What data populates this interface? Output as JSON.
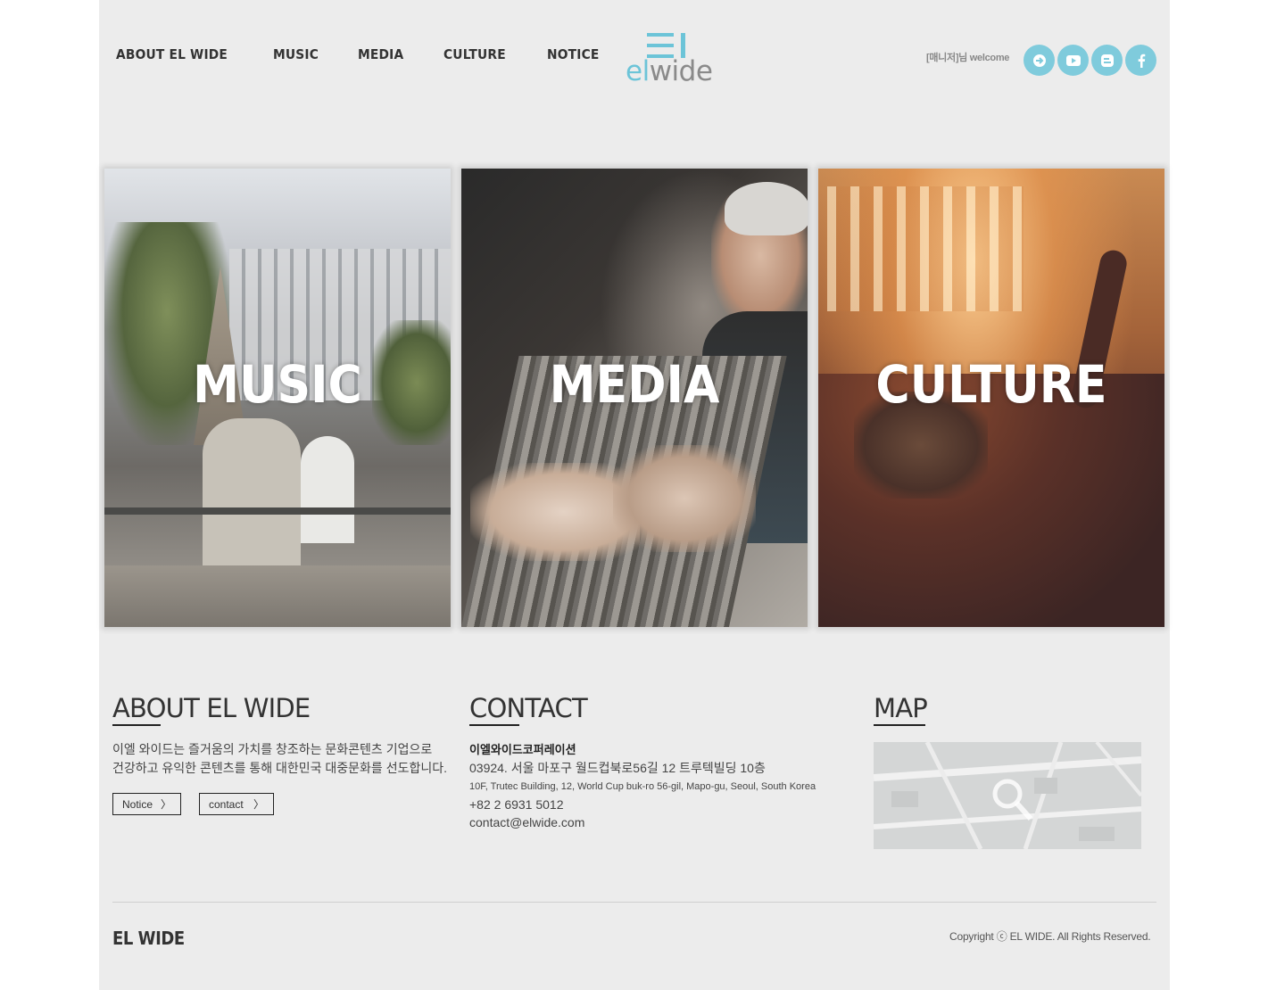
{
  "header": {
    "nav": [
      "ABOUT EL WIDE",
      "MUSIC",
      "MEDIA",
      "CULTURE",
      "NOTICE"
    ],
    "logo": {
      "part1": "el",
      "part2": "wide"
    },
    "welcome": "[매니저]님 welcome",
    "social_icons": [
      "login-arrow-icon",
      "youtube-icon",
      "blog-icon",
      "facebook-icon"
    ],
    "accent_color": "#7fcbdc"
  },
  "cards": [
    {
      "label": "MUSIC"
    },
    {
      "label": "MEDIA"
    },
    {
      "label": "CULTURE"
    }
  ],
  "about": {
    "title": "ABOUT EL WIDE",
    "line1": "이엘 와이드는 즐거움의 가치를 창조하는 문화콘텐츠 기업으로",
    "line2": "건강하고 유익한 콘텐츠를 통해 대한민국 대중문화를 선도합니다.",
    "notice_button": "Notice",
    "contact_button": "contact",
    "arrow": "〉"
  },
  "contact": {
    "title": "CONTACT",
    "company": "이엘와이드코퍼레이션",
    "address_ko": "03924. 서울 마포구 월드컵북로56길 12 트루텍빌딩 10층",
    "address_en": "10F, Trutec Building, 12, World Cup buk-ro 56-gil, Mapo-gu, Seoul, South Korea",
    "phone": "+82 2 6931 5012",
    "email": "contact@elwide.com"
  },
  "map": {
    "title": "MAP"
  },
  "footer": {
    "brand": "EL WIDE",
    "copyright": "Copyright ⓒ EL WIDE. All Rights Reserved."
  }
}
